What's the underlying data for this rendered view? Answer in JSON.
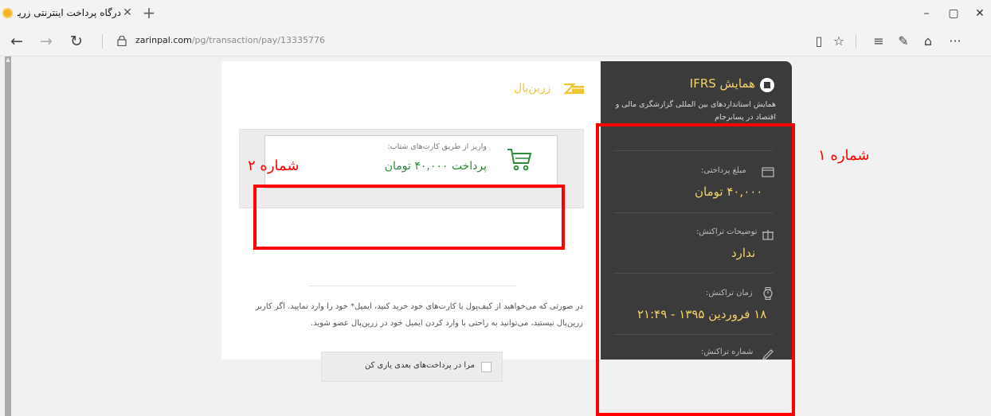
{
  "browser": {
    "tab_title": "درگاه پرداخت اینترنتی زرین",
    "tab_close": "✕",
    "new_tab": "+",
    "window": {
      "minimize": "–",
      "maximize": "▢",
      "close": "✕"
    },
    "nav": {
      "back": "←",
      "forward": "→",
      "refresh": "↻"
    },
    "url_domain": "zarinpal.com",
    "url_path": "/pg/transaction/pay/13335776",
    "tools": {
      "reading_view": "▯",
      "favorites": "☆",
      "hub": "≡",
      "notes": "✎",
      "share": "⌂",
      "more": "···"
    }
  },
  "sidebar": {
    "title": "همایش IFRS",
    "description": "همایش استانداردهای بین المللی گزارشگری مالی و اقتصاد در پسابرجام",
    "amount_label": "مبلغ پرداختی:",
    "amount_value": "۴۰,۰۰۰ تومان",
    "desc_label": "توضیحات تراکنش:",
    "desc_value": "ندارد",
    "time_label": "زمان تراکنش:",
    "time_value": "۱۸ فروردین ۱۳۹۵ - ۲۱:۴۹",
    "number_label": "شماره تراکنش:"
  },
  "main": {
    "logo": "زرین‌پال",
    "pay_subtitle": "واریز از طریق کارت‌های شتاب:",
    "pay_button": "پرداخت ۴۰,۰۰۰ تومان",
    "info_text": "در صورتی که می‌خواهید از کیف‌پول یا کارت‌های خود خرید کنید، ایمیل* خود را وارد نمایید. اگر کاربر زرین‌پال نیستید، می‌توانید به راحتی با وارد کردن ایمیل خود در زرین‌پال عضو شوید.",
    "remember_label": "مرا در پرداخت‌های بعدی یاری کن"
  },
  "annotations": {
    "label_1": "شماره ۱",
    "label_2": "شماره ۲",
    "color": "#ff0000"
  },
  "colors": {
    "sidebar_bg": "#3b3b3b",
    "accent_gold": "#f5d36a",
    "pay_green": "#2d8a3b"
  }
}
